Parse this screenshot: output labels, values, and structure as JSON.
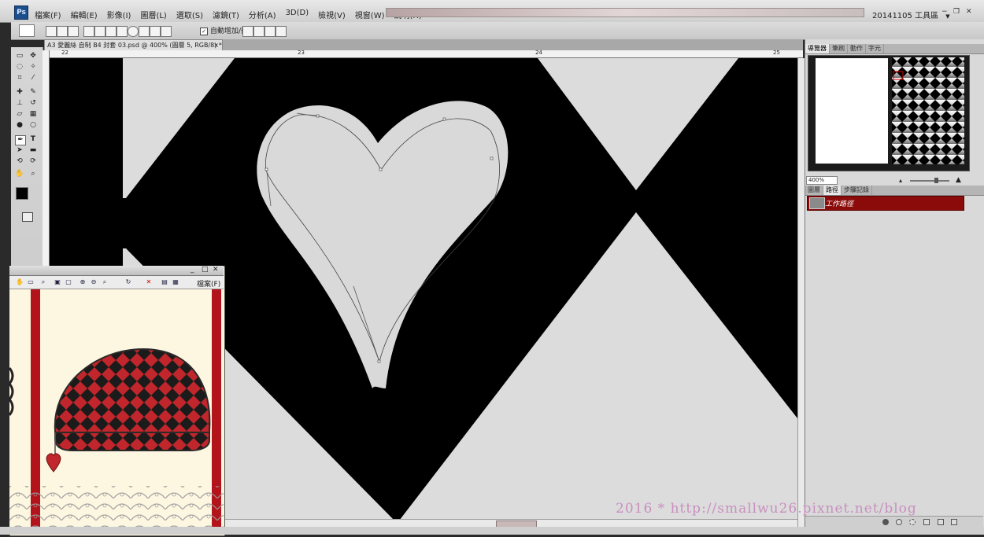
{
  "app": {
    "logo": "Ps",
    "menus": [
      "檔案(F)",
      "編輯(E)",
      "影像(I)",
      "圖層(L)",
      "選取(S)",
      "濾鏡(T)",
      "分析(A)",
      "3D(D)",
      "檢視(V)",
      "視窗(W)",
      "說明(H)"
    ],
    "workspace": "20141105 工具區",
    "workspace_arrow": "▼"
  },
  "options_bar": {
    "auto_add_delete_label": "自動增加/刪除",
    "auto_add_checked": true
  },
  "document": {
    "tab_title": "A3 愛麗絲 自制 B4 封套 03.psd @ 400% (圖層 5, RGB/8) *",
    "close": "×",
    "ruler_labels": [
      "22",
      "23",
      "24",
      "25"
    ]
  },
  "panels": {
    "top_tabs": [
      "導覽器",
      "筆刷",
      "動作",
      "字元"
    ],
    "active_top_tab": 0,
    "zoom_value": "400%",
    "bottom_tabs": [
      "圖層",
      "路徑",
      "步驟記錄"
    ],
    "active_bottom_tab": 1,
    "path_item_label": "工作路徑"
  },
  "viewer": {
    "menu_label": "檔案(F)"
  },
  "watermark": "2016 * http://smallwu26.pixnet.net/blog",
  "colors": {
    "accent_path": "#8b0a0a",
    "canvas_light": "#dcdcdc",
    "canvas_dark": "#000000",
    "bag_red": "#c0262b",
    "viewer_bg": "#fdf6e0"
  }
}
